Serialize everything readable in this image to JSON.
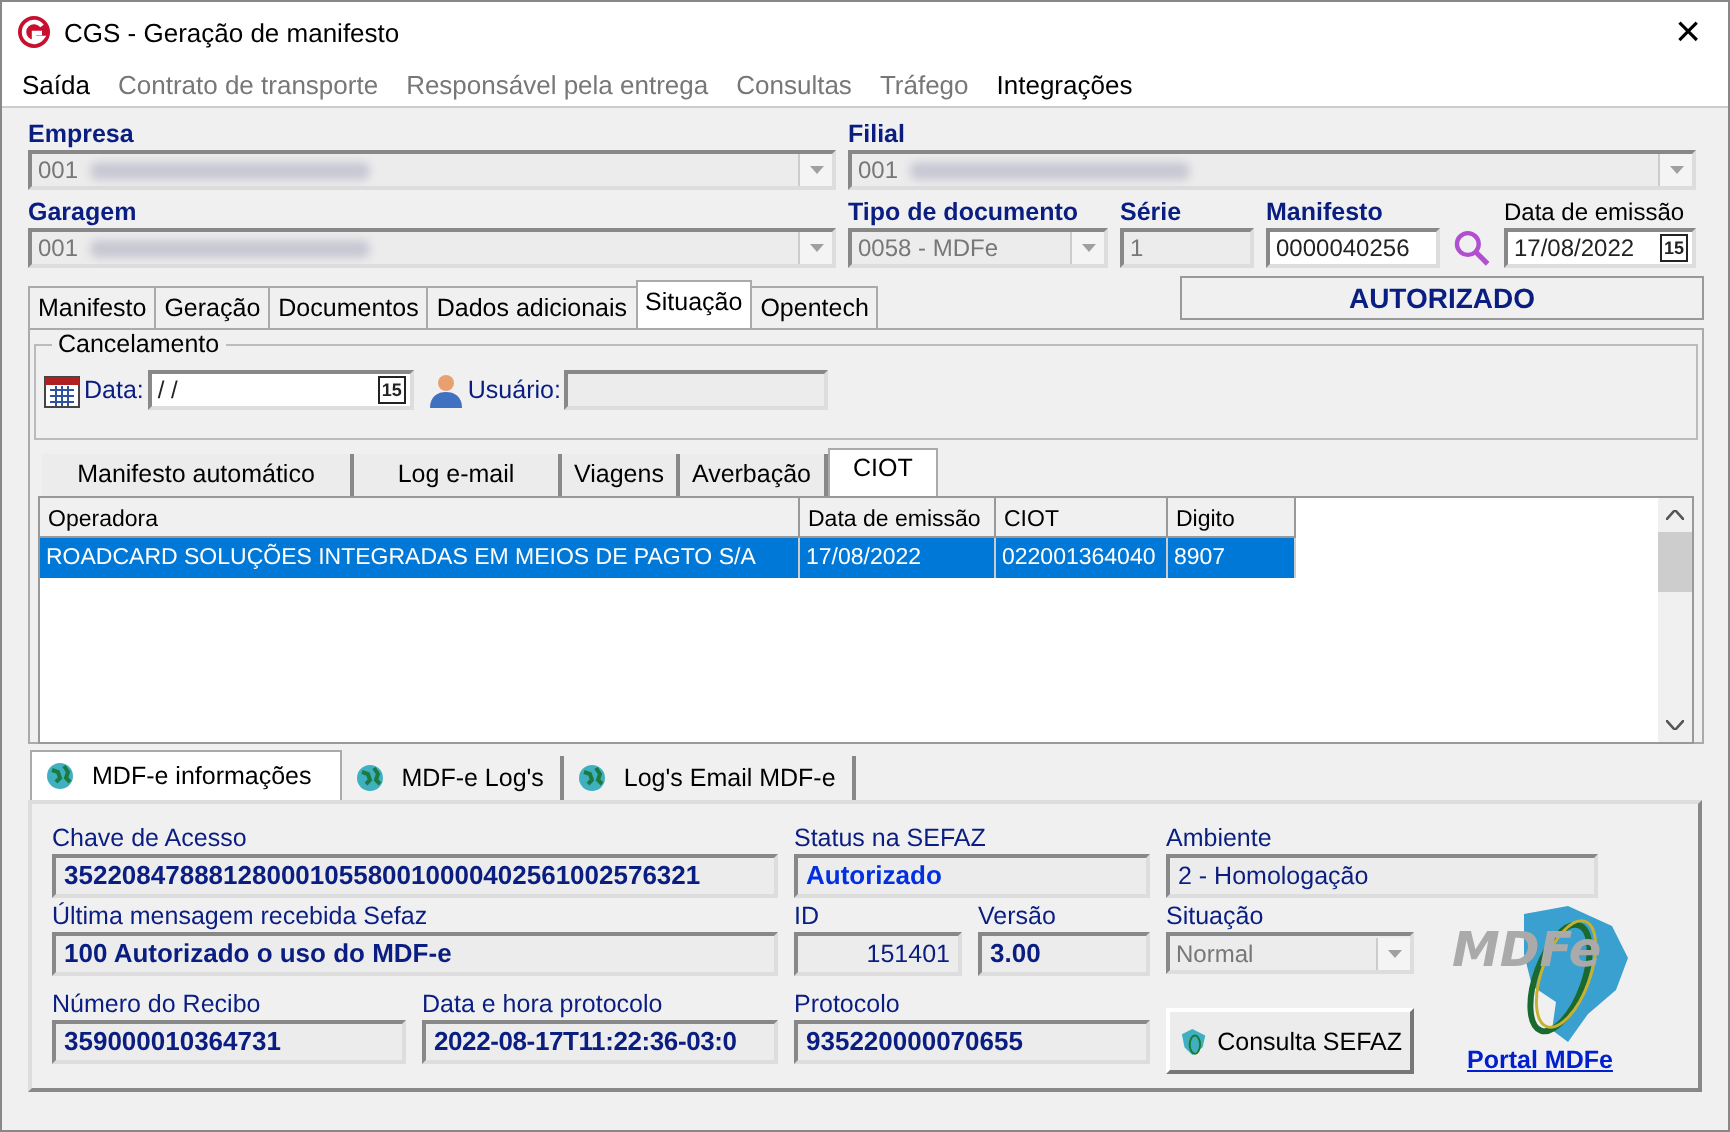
{
  "window": {
    "title": "CGS - Geração de manifesto",
    "close": "×"
  },
  "menu": [
    {
      "label": "Saída",
      "disabled": false
    },
    {
      "label": "Contrato de transporte",
      "disabled": true
    },
    {
      "label": "Responsável pela entrega",
      "disabled": true
    },
    {
      "label": "Consultas",
      "disabled": true
    },
    {
      "label": "Tráfego",
      "disabled": true
    },
    {
      "label": "Integrações",
      "disabled": false
    }
  ],
  "header_rows": [
    [
      {
        "label": "Empresa",
        "emphasis": true,
        "kind": "combo",
        "value": "001",
        "redacted": true,
        "disabled": true
      },
      {
        "label": "Filial",
        "emphasis": true,
        "kind": "combo",
        "value": "001",
        "redacted": true,
        "disabled": true
      }
    ],
    [
      {
        "label": "Garagem",
        "emphasis": true,
        "kind": "combo",
        "value": "001",
        "redacted": true,
        "disabled": true
      },
      {
        "label": "Tipo de documento",
        "emphasis": true,
        "kind": "combo",
        "value": "0058 - MDFe",
        "redacted": false,
        "disabled": true
      },
      {
        "label": "Série",
        "emphasis": true,
        "kind": "text",
        "value": "1",
        "disabled": true
      },
      {
        "label": "Manifesto",
        "emphasis": true,
        "kind": "search",
        "value": "0000040256",
        "disabled": false
      },
      {
        "label": "Data de emissão",
        "emphasis": false,
        "kind": "date",
        "value": "17/08/2022",
        "picker": "15",
        "disabled": false
      }
    ]
  ],
  "tabs": [
    {
      "label": "Manifesto",
      "selected": false
    },
    {
      "label": "Geração",
      "selected": false
    },
    {
      "label": "Documentos",
      "selected": false
    },
    {
      "label": "Dados adicionais",
      "selected": false
    },
    {
      "label": "Situação",
      "selected": true
    },
    {
      "label": "Opentech",
      "selected": false
    }
  ],
  "status_badge": "AUTORIZADO",
  "cancelamento": {
    "title": "Cancelamento",
    "date_label": "Data:",
    "date_value": "/ /",
    "date_picker": "15",
    "user_label": "Usuário:"
  },
  "inner_tabs": [
    {
      "label": "Manifesto automático",
      "selected": false
    },
    {
      "label": "Log e-mail",
      "selected": false
    },
    {
      "label": "Viagens",
      "selected": false
    },
    {
      "label": "Averbação",
      "selected": false
    },
    {
      "label": "CIOT",
      "selected": true
    }
  ],
  "grid": {
    "columns": [
      "Operadora",
      "Data de emissão",
      "CIOT",
      "Digito"
    ],
    "rows": [
      {
        "cells": [
          "ROADCARD SOLUÇÕES INTEGRADAS EM MEIOS DE PAGTO S/A",
          "17/08/2022",
          "022001364040",
          "8907"
        ],
        "selected": true
      }
    ]
  },
  "bottom_tabs": [
    {
      "label": "MDF-e informações",
      "selected": true
    },
    {
      "label": "MDF-e Log's",
      "selected": false
    },
    {
      "label": "Log's Email MDF-e",
      "selected": false
    }
  ],
  "info_rows": [
    [
      {
        "label": "Chave de Acesso",
        "kind": "text",
        "value": "35220847888128000105580010000402561002576321",
        "bold": true,
        "highlight": false
      },
      {
        "label": "Status na SEFAZ",
        "kind": "text",
        "value": "Autorizado",
        "bold": true,
        "highlight": true
      },
      {
        "label": "Ambiente",
        "kind": "text",
        "value": "2 - Homologação",
        "bold": false,
        "highlight": false
      }
    ],
    [
      {
        "label": "Última mensagem recebida Sefaz",
        "kind": "text",
        "value": "100 Autorizado o uso do MDF-e",
        "bold": true,
        "highlight": false
      },
      {
        "label": "ID",
        "kind": "number",
        "value": "151401",
        "bold": false,
        "highlight": false
      },
      {
        "label": "Versão",
        "kind": "text",
        "value": "3.00",
        "bold": true,
        "highlight": false
      },
      {
        "label": "Situação",
        "kind": "combo",
        "value": "Normal",
        "bold": false,
        "highlight": false
      }
    ],
    [
      {
        "label": "Número do Recibo",
        "kind": "text",
        "value": "359000010364731",
        "bold": true,
        "highlight": false
      },
      {
        "label": "Data e hora protocolo",
        "kind": "text",
        "value": "2022-08-17T11:22:36-03:0",
        "bold": true,
        "highlight": false
      },
      {
        "label": "Protocolo",
        "kind": "text",
        "value": "935220000070655",
        "bold": true,
        "highlight": false
      }
    ]
  ],
  "consult_button": "Consulta SEFAZ",
  "logo_text": "MDFe",
  "portal_link": "Portal MDFe"
}
